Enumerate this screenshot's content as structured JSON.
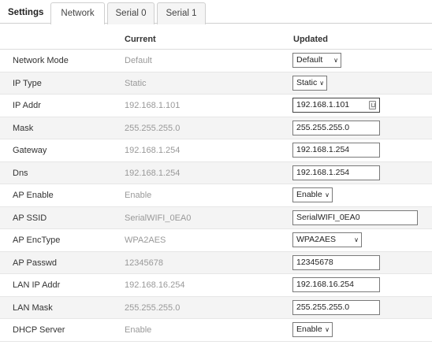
{
  "tabs": {
    "title": "Settings",
    "items": [
      {
        "label": "Network",
        "active": true
      },
      {
        "label": "Serial 0",
        "active": false
      },
      {
        "label": "Serial 1",
        "active": false
      }
    ]
  },
  "header": {
    "current": "Current",
    "updated": "Updated"
  },
  "rows": [
    {
      "label": "Network Mode",
      "current": "Default",
      "updated": "Default",
      "control": "select"
    },
    {
      "label": "IP Type",
      "current": "Static",
      "updated": "Static",
      "control": "select"
    },
    {
      "label": "IP Addr",
      "current": "192.168.1.101",
      "updated": "192.168.1.101",
      "control": "text-ip"
    },
    {
      "label": "Mask",
      "current": "255.255.255.0",
      "updated": "255.255.255.0",
      "control": "text"
    },
    {
      "label": "Gateway",
      "current": "192.168.1.254",
      "updated": "192.168.1.254",
      "control": "text"
    },
    {
      "label": "Dns",
      "current": "192.168.1.254",
      "updated": "192.168.1.254",
      "control": "text"
    },
    {
      "label": "AP Enable",
      "current": "Enable",
      "updated": "Enable",
      "control": "select"
    },
    {
      "label": "AP SSID",
      "current": "SerialWIFI_0EA0",
      "updated": "SerialWIFI_0EA0",
      "control": "text-wide"
    },
    {
      "label": "AP EncType",
      "current": "WPA2AES",
      "updated": "WPA2AES",
      "control": "select"
    },
    {
      "label": "AP Passwd",
      "current": "12345678",
      "updated": "12345678",
      "control": "text"
    },
    {
      "label": "LAN IP Addr",
      "current": "192.168.16.254",
      "updated": "192.168.16.254",
      "control": "text"
    },
    {
      "label": "LAN Mask",
      "current": "255.255.255.0",
      "updated": "255.255.255.0",
      "control": "text"
    },
    {
      "label": "DHCP Server",
      "current": "Enable",
      "updated": "Enable",
      "control": "select"
    }
  ],
  "colors": {
    "border": "#cfcfcf",
    "row_alt": "#f4f4f4",
    "muted_text": "#999999"
  }
}
